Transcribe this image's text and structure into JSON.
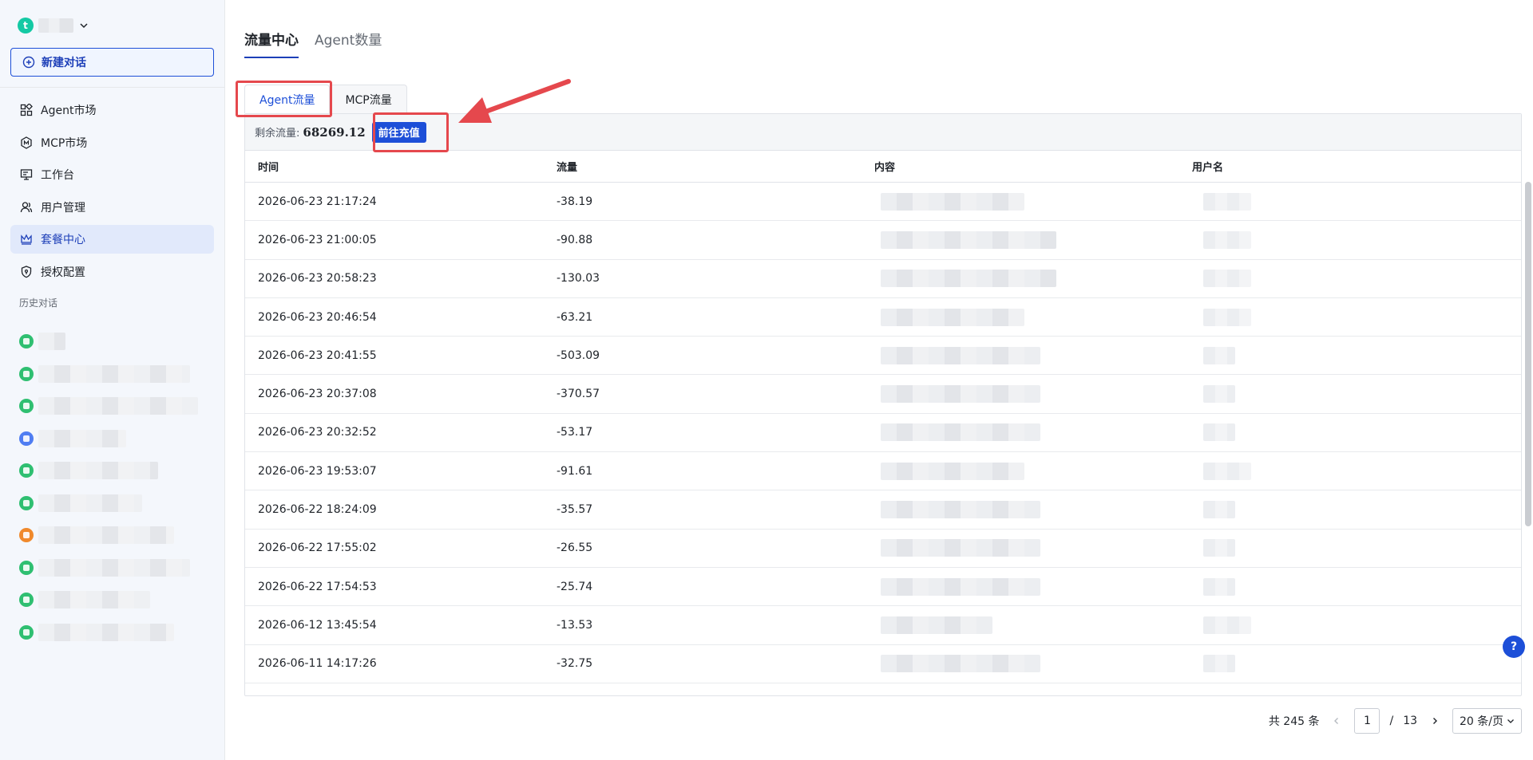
{
  "sidebar": {
    "workspace_initial": "t",
    "new_chat": "新建对话",
    "nav": [
      {
        "label": "Agent市场",
        "icon": "grid-icon"
      },
      {
        "label": "MCP市场",
        "icon": "mcp-icon"
      },
      {
        "label": "工作台",
        "icon": "monitor-icon"
      },
      {
        "label": "用户管理",
        "icon": "users-icon"
      },
      {
        "label": "套餐中心",
        "icon": "crown-icon"
      },
      {
        "label": "授权配置",
        "icon": "shield-icon"
      }
    ],
    "history_label": "历史对话",
    "history_colors": [
      "#2fbf71",
      "#2fbf71",
      "#2fbf71",
      "#4f7df2",
      "#2fbf71",
      "#2fbf71",
      "#f0892c",
      "#2fbf71",
      "#2fbf71",
      "#2fbf71"
    ]
  },
  "main": {
    "tabs": [
      "流量中心",
      "Agent数量"
    ],
    "sub_tabs": [
      "Agent流量",
      "MCP流量"
    ],
    "balance_label": "剩余流量:",
    "balance_value": "68269.12",
    "recharge": "前往充值",
    "columns": [
      "时间",
      "流量",
      "内容",
      "用户名"
    ],
    "rows": [
      {
        "time": "2026-06-23 21:17:24",
        "flow": "-38.19"
      },
      {
        "time": "2026-06-23 21:00:05",
        "flow": "-90.88"
      },
      {
        "time": "2026-06-23 20:58:23",
        "flow": "-130.03"
      },
      {
        "time": "2026-06-23 20:46:54",
        "flow": "-63.21"
      },
      {
        "time": "2026-06-23 20:41:55",
        "flow": "-503.09"
      },
      {
        "time": "2026-06-23 20:37:08",
        "flow": "-370.57"
      },
      {
        "time": "2026-06-23 20:32:52",
        "flow": "-53.17"
      },
      {
        "time": "2026-06-23 19:53:07",
        "flow": "-91.61"
      },
      {
        "time": "2026-06-22 18:24:09",
        "flow": "-35.57"
      },
      {
        "time": "2026-06-22 17:55:02",
        "flow": "-26.55"
      },
      {
        "time": "2026-06-22 17:54:53",
        "flow": "-25.74"
      },
      {
        "time": "2026-06-12 13:45:54",
        "flow": "-13.53"
      },
      {
        "time": "2026-06-11 14:17:26",
        "flow": "-32.75"
      }
    ],
    "pager": {
      "total": "共 245 条",
      "current": "1",
      "sep": "/",
      "pages": "13",
      "size": "20 条/页"
    },
    "help": "?"
  }
}
